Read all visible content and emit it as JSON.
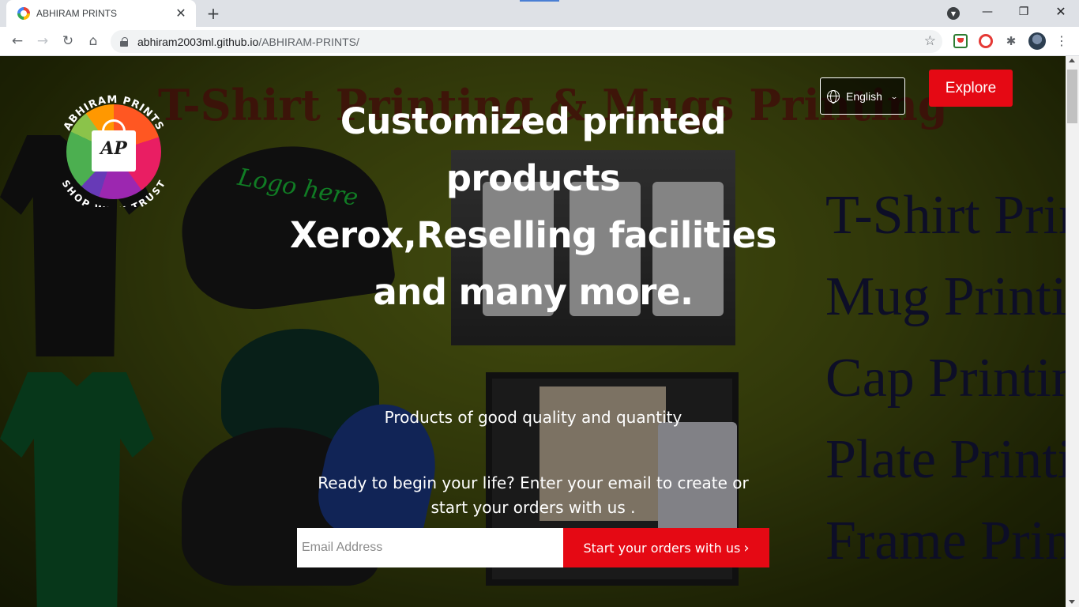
{
  "browser": {
    "tab": {
      "title": "ABHIRAM PRINTS",
      "close_glyph": "✕"
    },
    "new_tab_glyph": "+",
    "window_controls": {
      "minimize": "—",
      "maximize": "❐",
      "close": "✕"
    },
    "nav": {
      "back": "←",
      "forward": "→",
      "reload": "↻",
      "home": "⌂"
    },
    "url": {
      "host": "abhiram2003ml.github.io",
      "path": "/ABHIRAM-PRINTS/"
    },
    "star_glyph": "☆",
    "menu_glyph": "⋮",
    "puzzle_glyph": "✱"
  },
  "page": {
    "logo": {
      "ring_top": "ABHIRAM PRINTS",
      "ring_bottom": "SHOP WITH TRUST",
      "monogram": "AP"
    },
    "background": {
      "banner": "T-Shirt Printing & Mugs Printing",
      "services": [
        "T-Shirt Printi",
        "Mug Printing",
        "Cap Printing",
        "Plate Printin",
        "Frame Printi"
      ],
      "cap_text": "Logo here"
    },
    "language": {
      "label": "English",
      "caret": "⌄"
    },
    "explore_label": "Explore",
    "hero": {
      "title_lines": [
        "Customized printed",
        "products",
        "Xerox,Reselling facilities",
        "and many more."
      ],
      "subtitle": "Products of good quality and quantity",
      "cta_line1": "Ready to begin your life? Enter your email to create or",
      "cta_line2": "start your orders with us ."
    },
    "email_form": {
      "placeholder": "Email Address",
      "value": "",
      "submit_label": "Start your orders with us",
      "submit_chevron": "›"
    }
  },
  "colors": {
    "accent_red": "#e50914",
    "chrome_bg": "#dee1e6",
    "omnibox_bg": "#f1f3f4"
  }
}
